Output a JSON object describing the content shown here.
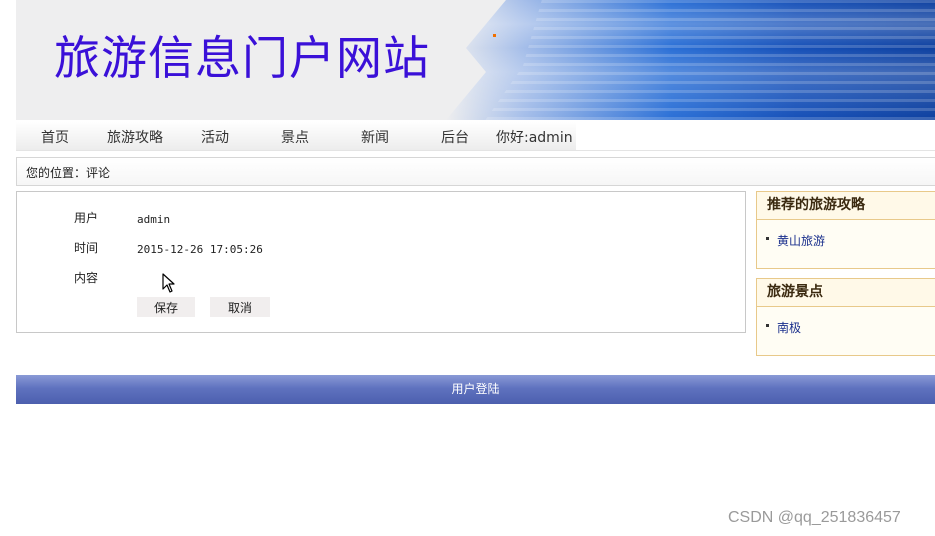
{
  "banner": {
    "site_title": "旅游信息门户网站"
  },
  "nav": {
    "items": [
      "首页",
      "旅游攻略",
      "活动",
      "景点",
      "新闻",
      "后台"
    ],
    "greeting": "你好:admin"
  },
  "breadcrumb": {
    "text": "您的位置：评论"
  },
  "form": {
    "user_label": "用户",
    "user_value": "admin",
    "time_label": "时间",
    "time_value": "2015-12-26 17:05:26",
    "content_label": "内容",
    "save_label": "保存",
    "cancel_label": "取消"
  },
  "sidebar": {
    "guides": {
      "title": "推荐的旅游攻略",
      "items": [
        "黄山旅游"
      ]
    },
    "spots": {
      "title": "旅游景点",
      "items": [
        "南极"
      ]
    }
  },
  "footer": {
    "login_label": "用户登陆"
  },
  "watermark": "CSDN @qq_251836457"
}
